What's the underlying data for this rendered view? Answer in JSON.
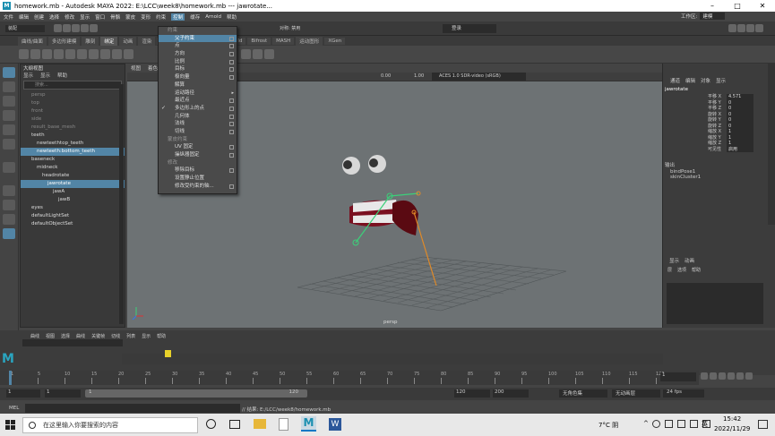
{
  "window": {
    "app_icon": "M",
    "title": "homework.mb - Autodesk MAYA 2022: E:\\LCC\\week8\\homework.mb  ---  jawrotate..."
  },
  "menubar": [
    "文件",
    "编辑",
    "创建",
    "选择",
    "修改",
    "显示",
    "窗口",
    "骨骼",
    "蒙皮",
    "变形",
    "约束",
    "控制",
    "缓存",
    "Arnold",
    "帮助"
  ],
  "menubar_highlight_index": 11,
  "workspace": {
    "label": "工作区:",
    "value": "建模"
  },
  "status_line": {
    "mode": "装配",
    "symmetry": "对称: 禁用",
    "login": "登录"
  },
  "shelf_tabs": [
    "曲线/曲面",
    "多边形建模",
    "雕刻",
    "绑定",
    "动画",
    "渲染",
    "FX",
    "FX 缓存",
    "自定义",
    "Arnold",
    "Bifrost",
    "MASH",
    "运动图形",
    "XGen"
  ],
  "shelf_active": 3,
  "outliner": {
    "title": "大纲视图",
    "menu": [
      "显示",
      "显示",
      "帮助"
    ],
    "search_placeholder": "搜索...",
    "items": [
      {
        "label": "persp",
        "indent": 1,
        "state": "dim"
      },
      {
        "label": "top",
        "indent": 1,
        "state": "dim"
      },
      {
        "label": "front",
        "indent": 1,
        "state": "dim"
      },
      {
        "label": "side",
        "indent": 1,
        "state": "dim"
      },
      {
        "label": "result_base_mesh",
        "indent": 1,
        "state": "dim"
      },
      {
        "label": "teeth",
        "indent": 1,
        "state": "normal"
      },
      {
        "label": "newteethtop_teeth",
        "indent": 2,
        "state": "normal"
      },
      {
        "label": "newteeth:bottom_teeth",
        "indent": 2,
        "state": "sel"
      },
      {
        "label": "baseneck",
        "indent": 1,
        "state": "normal"
      },
      {
        "label": "midneck",
        "indent": 2,
        "state": "normal"
      },
      {
        "label": "headrotate",
        "indent": 3,
        "state": "normal"
      },
      {
        "label": "jawrotate",
        "indent": 4,
        "state": "sel"
      },
      {
        "label": "jawA",
        "indent": 5,
        "state": "normal"
      },
      {
        "label": "jawB",
        "indent": 6,
        "state": "normal"
      },
      {
        "label": "eyes",
        "indent": 1,
        "state": "normal"
      },
      {
        "label": "defaultLightSet",
        "indent": 1,
        "state": "normal"
      },
      {
        "label": "defaultObjectSet",
        "indent": 1,
        "state": "normal"
      }
    ]
  },
  "viewport": {
    "menu": [
      "视图",
      "着色",
      "照明",
      "显示",
      "渲染器",
      "面板"
    ],
    "camera_label": "persp",
    "values": {
      "exposure": "0.00",
      "gamma": "1.00",
      "colorspace": "ACES 1.0 SDR-video (sRGB)"
    }
  },
  "constrain_menu": {
    "items": [
      {
        "label": "约束",
        "type": "head"
      },
      {
        "label": "父子约束",
        "type": "item",
        "box": true,
        "highlight": true
      },
      {
        "label": "点",
        "type": "item",
        "box": true
      },
      {
        "label": "方向",
        "type": "item",
        "box": true
      },
      {
        "label": "比例",
        "type": "item",
        "box": true
      },
      {
        "label": "目标",
        "type": "item",
        "box": true
      },
      {
        "label": "极向量",
        "type": "item",
        "box": true
      },
      {
        "label": "解算",
        "type": "item"
      },
      {
        "label": "运动路径",
        "type": "item",
        "arrow": true
      },
      {
        "label": "最近点",
        "type": "item",
        "box": true
      },
      {
        "label": "多边形上的点",
        "type": "item",
        "box": true,
        "check": true
      },
      {
        "label": "几何体",
        "type": "item",
        "box": true
      },
      {
        "label": "法线",
        "type": "item",
        "box": true
      },
      {
        "label": "切线",
        "type": "item",
        "box": true
      },
      {
        "label": "蒙皮约束",
        "type": "head"
      },
      {
        "label": "UV 固定",
        "type": "item",
        "box": true
      },
      {
        "label": "操纵器固定",
        "type": "item",
        "box": true
      },
      {
        "label": "修改",
        "type": "head"
      },
      {
        "label": "移除目标",
        "type": "item",
        "box": true
      },
      {
        "label": "设置静止位置",
        "type": "item"
      },
      {
        "label": "修改受约束的轴...",
        "type": "item",
        "box": true
      }
    ]
  },
  "channel_box": {
    "tabs": [
      "通道",
      "编辑",
      "对象",
      "显示"
    ],
    "object": "jawrotate",
    "attrs": [
      {
        "name": "平移 X",
        "value": "4.571"
      },
      {
        "name": "平移 Y",
        "value": "0"
      },
      {
        "name": "平移 Z",
        "value": "0"
      },
      {
        "name": "旋转 X",
        "value": "0"
      },
      {
        "name": "旋转 Y",
        "value": "0"
      },
      {
        "name": "旋转 Z",
        "value": "0"
      },
      {
        "name": "缩放 X",
        "value": "1"
      },
      {
        "name": "缩放 Y",
        "value": "1"
      },
      {
        "name": "缩放 Z",
        "value": "1"
      },
      {
        "name": "可见性",
        "value": "启用"
      }
    ],
    "inputs_label": "输出",
    "inputs": [
      "bindPose1",
      "skinCluster1"
    ]
  },
  "layers": {
    "tabs": [
      "显示",
      "动画"
    ],
    "menu": [
      "层",
      "选项",
      "帮助"
    ]
  },
  "anim_shelf_tabs": [
    "曲线",
    "视图",
    "选择",
    "曲线",
    "关键帧",
    "切线",
    "列表",
    "显示",
    "帮助"
  ],
  "time": {
    "ticks": [
      "1",
      "5",
      "10",
      "15",
      "20",
      "25",
      "30",
      "35",
      "40",
      "45",
      "50",
      "55",
      "60",
      "65",
      "70",
      "75",
      "80",
      "85",
      "90",
      "95",
      "100",
      "105",
      "110",
      "115",
      "120"
    ],
    "current_frame": "1",
    "range_start": "1",
    "range_inner_start": "1",
    "range_inner_end": "120",
    "range_end_a": "120",
    "range_end_b": "200",
    "char_set": "无角色集",
    "anim_layer": "无动画层",
    "fps": "24 fps"
  },
  "command_line": {
    "lang": "MEL",
    "result": "// 结果: E:/LCC/week8/homework.mb"
  },
  "taskbar": {
    "search_placeholder": "在这里输入你要搜索的内容",
    "weather": "7°C 阴",
    "ime": "英",
    "time": "15:42",
    "date": "2022/11/29"
  }
}
